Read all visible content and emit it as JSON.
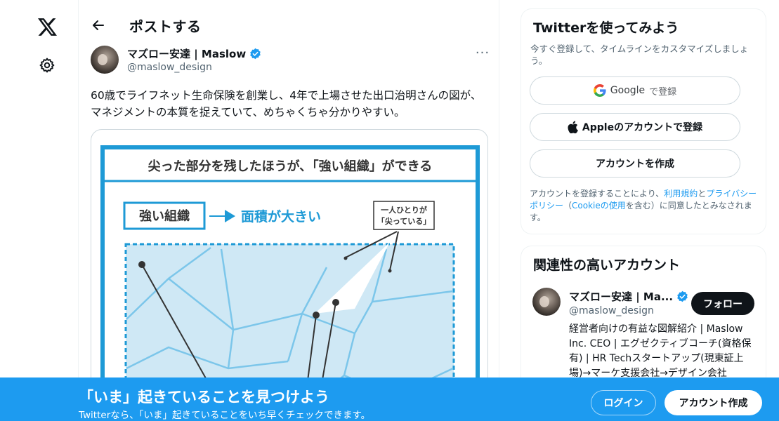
{
  "nav": {
    "logo_icon": "x-logo-icon",
    "settings_icon": "gear-icon"
  },
  "header": {
    "title": "ポストする",
    "back_icon": "arrow-left-icon"
  },
  "post": {
    "author_name": "マズロー安達 | Maslow",
    "author_handle": "@maslow_design",
    "verified": true,
    "more_label": "···",
    "text": "60歳でライフネット生命保険を創業し、4年で上場させた出口治明さんの図が、マネジメントの本質を捉えていて、めちゃくちゃ分かりやすい。",
    "image": {
      "heading": "尖った部分を残したほうが､「強い組織」ができる",
      "box_label": "強い組織",
      "arrow_label": "面積が大きい",
      "callout": [
        "一人ひとりが",
        "「尖っている」"
      ]
    }
  },
  "signup_card": {
    "title": "Twitterを使ってみよう",
    "description": "今すぐ登録して、タイムラインをカスタマイズしましょう。",
    "google_label": "Google",
    "google_suffix": "で登録",
    "apple_label": "Appleのアカウントで登録",
    "create_label": "アカウントを作成",
    "legal_prefix": "アカウントを登録することにより、",
    "terms_link": "利用規約",
    "legal_and": "と",
    "privacy_link": "プライバシーポリシー",
    "legal_open": "（",
    "cookie_link": "Cookieの使用",
    "legal_suffix": "を含む）に同意したとみなされます。"
  },
  "related": {
    "title": "関連性の高いアカウント",
    "name": "マズロー安達 | Ma...",
    "handle": "@maslow_design",
    "follow_label": "フォロー",
    "bio": "経営者向けの有益な図解紹介 | Maslow Inc. CEO | エグゼクティブコーチ(資格保有) | HR Techスタートアップ(現東証上場)→マーケ支援会社→デザイン会社"
  },
  "banner": {
    "title": "「いま」起きていることを見つけよう",
    "subtitle": "Twitterなら、「いま」起きていることをいち早くチェックできます。",
    "login_label": "ログイン",
    "signup_label": "アカウント作成"
  },
  "colors": {
    "accent": "#1d9bf0",
    "verified": "#1d9bf0",
    "diagram_blue": "#1e9ad6",
    "diagram_fill": "#cfe8f5"
  }
}
